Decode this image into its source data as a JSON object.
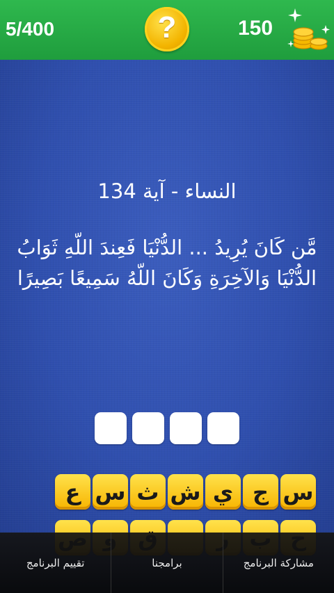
{
  "header": {
    "level": "5/400",
    "help_symbol": "?",
    "coins": "150",
    "coins_icon": "coins-stack-icon",
    "help_icon": "question-coin-icon"
  },
  "puzzle": {
    "surah_ref": "النساء - آية 134",
    "verse": "مَّن كَانَ يُرِيدُ ... الدُّنْيَا فَعِندَ اللّهِ ثَوَابُ الدُّنْيَا وَالآخِرَةِ وَكَانَ اللّهُ سَمِيعًا بَصِيرًا",
    "answer_slots": 4
  },
  "letters": {
    "row1": [
      "س",
      "ج",
      "ي",
      "ش",
      "ث",
      "س",
      "ع"
    ],
    "row2": [
      "ح",
      "ب",
      "ر",
      "",
      "ق",
      "و",
      "ص"
    ]
  },
  "nav": {
    "share": "مشاركة البرنامج",
    "apps": "برامجنا",
    "rate": "تقييم البرنامج"
  },
  "colors": {
    "header_green": "#27ab45",
    "board_blue": "#2f4fae",
    "tile_yellow": "#f7b400"
  }
}
